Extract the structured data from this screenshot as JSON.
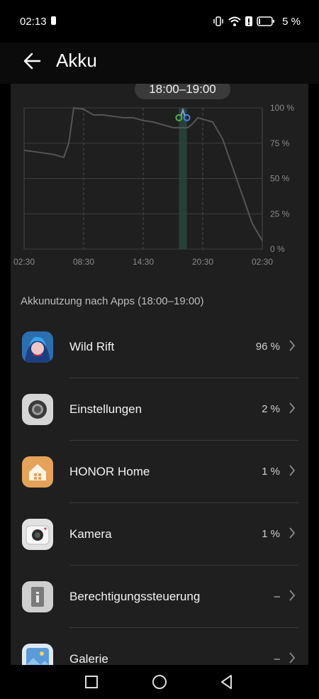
{
  "status": {
    "time": "02:13",
    "battery_pct": "5 %"
  },
  "header": {
    "title": "Akku"
  },
  "chart_data": {
    "type": "line",
    "title": "",
    "xlabel": "",
    "ylabel": "",
    "x_ticks": [
      "02:30",
      "08:30",
      "14:30",
      "20:30",
      "02:30"
    ],
    "y_ticks": [
      "100 %",
      "75 %",
      "50 %",
      "25 %",
      "0 %"
    ],
    "ylim": [
      0,
      100
    ],
    "x_hours": [
      0,
      1,
      2,
      3,
      3.5,
      4,
      4.5,
      5,
      6,
      7,
      8,
      9,
      10,
      11,
      12,
      13,
      14,
      15,
      15.5,
      16,
      16.5,
      17,
      17.5,
      18,
      19,
      20,
      21,
      22,
      23,
      24
    ],
    "values": [
      70,
      69,
      68,
      67,
      66,
      65,
      75,
      100,
      99,
      95,
      95,
      94,
      93,
      93,
      91,
      90,
      88,
      86,
      86,
      86,
      86,
      89,
      93,
      92,
      90,
      78,
      58,
      38,
      18,
      6
    ],
    "selected_range": "18:00–19:00",
    "grid": true
  },
  "section": {
    "title": "Akkunutzung nach Apps (18:00–19:00)"
  },
  "apps": [
    {
      "name": "Wild Rift",
      "pct": "96 %",
      "icon": "wild-rift-icon"
    },
    {
      "name": "Einstellungen",
      "pct": "2 %",
      "icon": "settings-icon"
    },
    {
      "name": "HONOR Home",
      "pct": "1 %",
      "icon": "home-icon"
    },
    {
      "name": "Kamera",
      "pct": "1 %",
      "icon": "camera-icon"
    },
    {
      "name": "Berechtigungssteuerung",
      "pct": "–",
      "icon": "permission-icon"
    },
    {
      "name": "Galerie",
      "pct": "–",
      "icon": "gallery-icon"
    }
  ],
  "colors": {
    "background": "#000000",
    "card": "#1f1f1f",
    "line": "#555555",
    "handle_green": "#4caf50",
    "handle_blue": "#4a7fe0"
  }
}
